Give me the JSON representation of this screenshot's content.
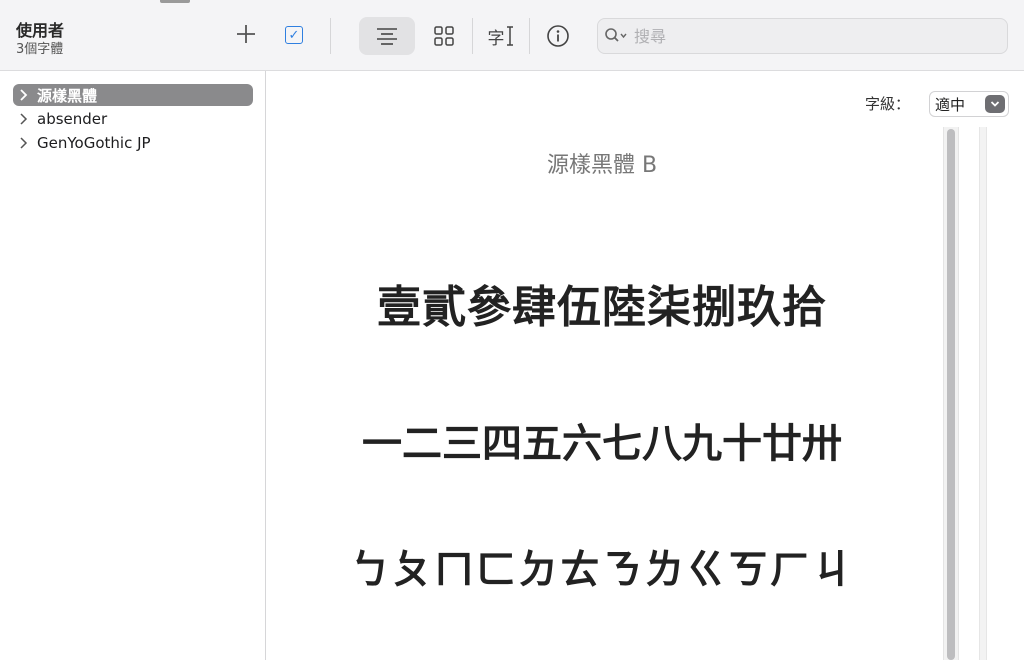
{
  "collection": {
    "title": "使用者",
    "count": "3個字體"
  },
  "toolbar": {
    "add_icon": "plus-icon",
    "check_icon": "checkbox-icon",
    "view_sample_icon": "sample-view-icon",
    "view_grid_icon": "grid-view-icon",
    "view_custom_icon": "custom-text-icon",
    "view_custom_glyph": "字",
    "info_icon": "info-icon"
  },
  "search": {
    "placeholder": "搜尋",
    "value": ""
  },
  "sidebar": {
    "items": [
      {
        "label": "源樣黑體",
        "selected": true,
        "expanded": false
      },
      {
        "label": "absender",
        "selected": false,
        "expanded": false
      },
      {
        "label": "GenYoGothic JP",
        "selected": false,
        "expanded": false
      }
    ]
  },
  "preview": {
    "size_label": "字級：",
    "size_value": "適中",
    "font_name": "源樣黑體 B",
    "samples": [
      "壹貳參肆伍陸柒捌玖拾",
      "一二三四五六七八九十廿卅",
      "ㄅㄆㄇㄈㄉㄊㄋㄌㄍㄎㄏㄐ"
    ]
  },
  "colors": {
    "accent": "#2f7fe0",
    "selection": "#8a8a8c",
    "toolbar_bg": "#f4f4f6"
  }
}
